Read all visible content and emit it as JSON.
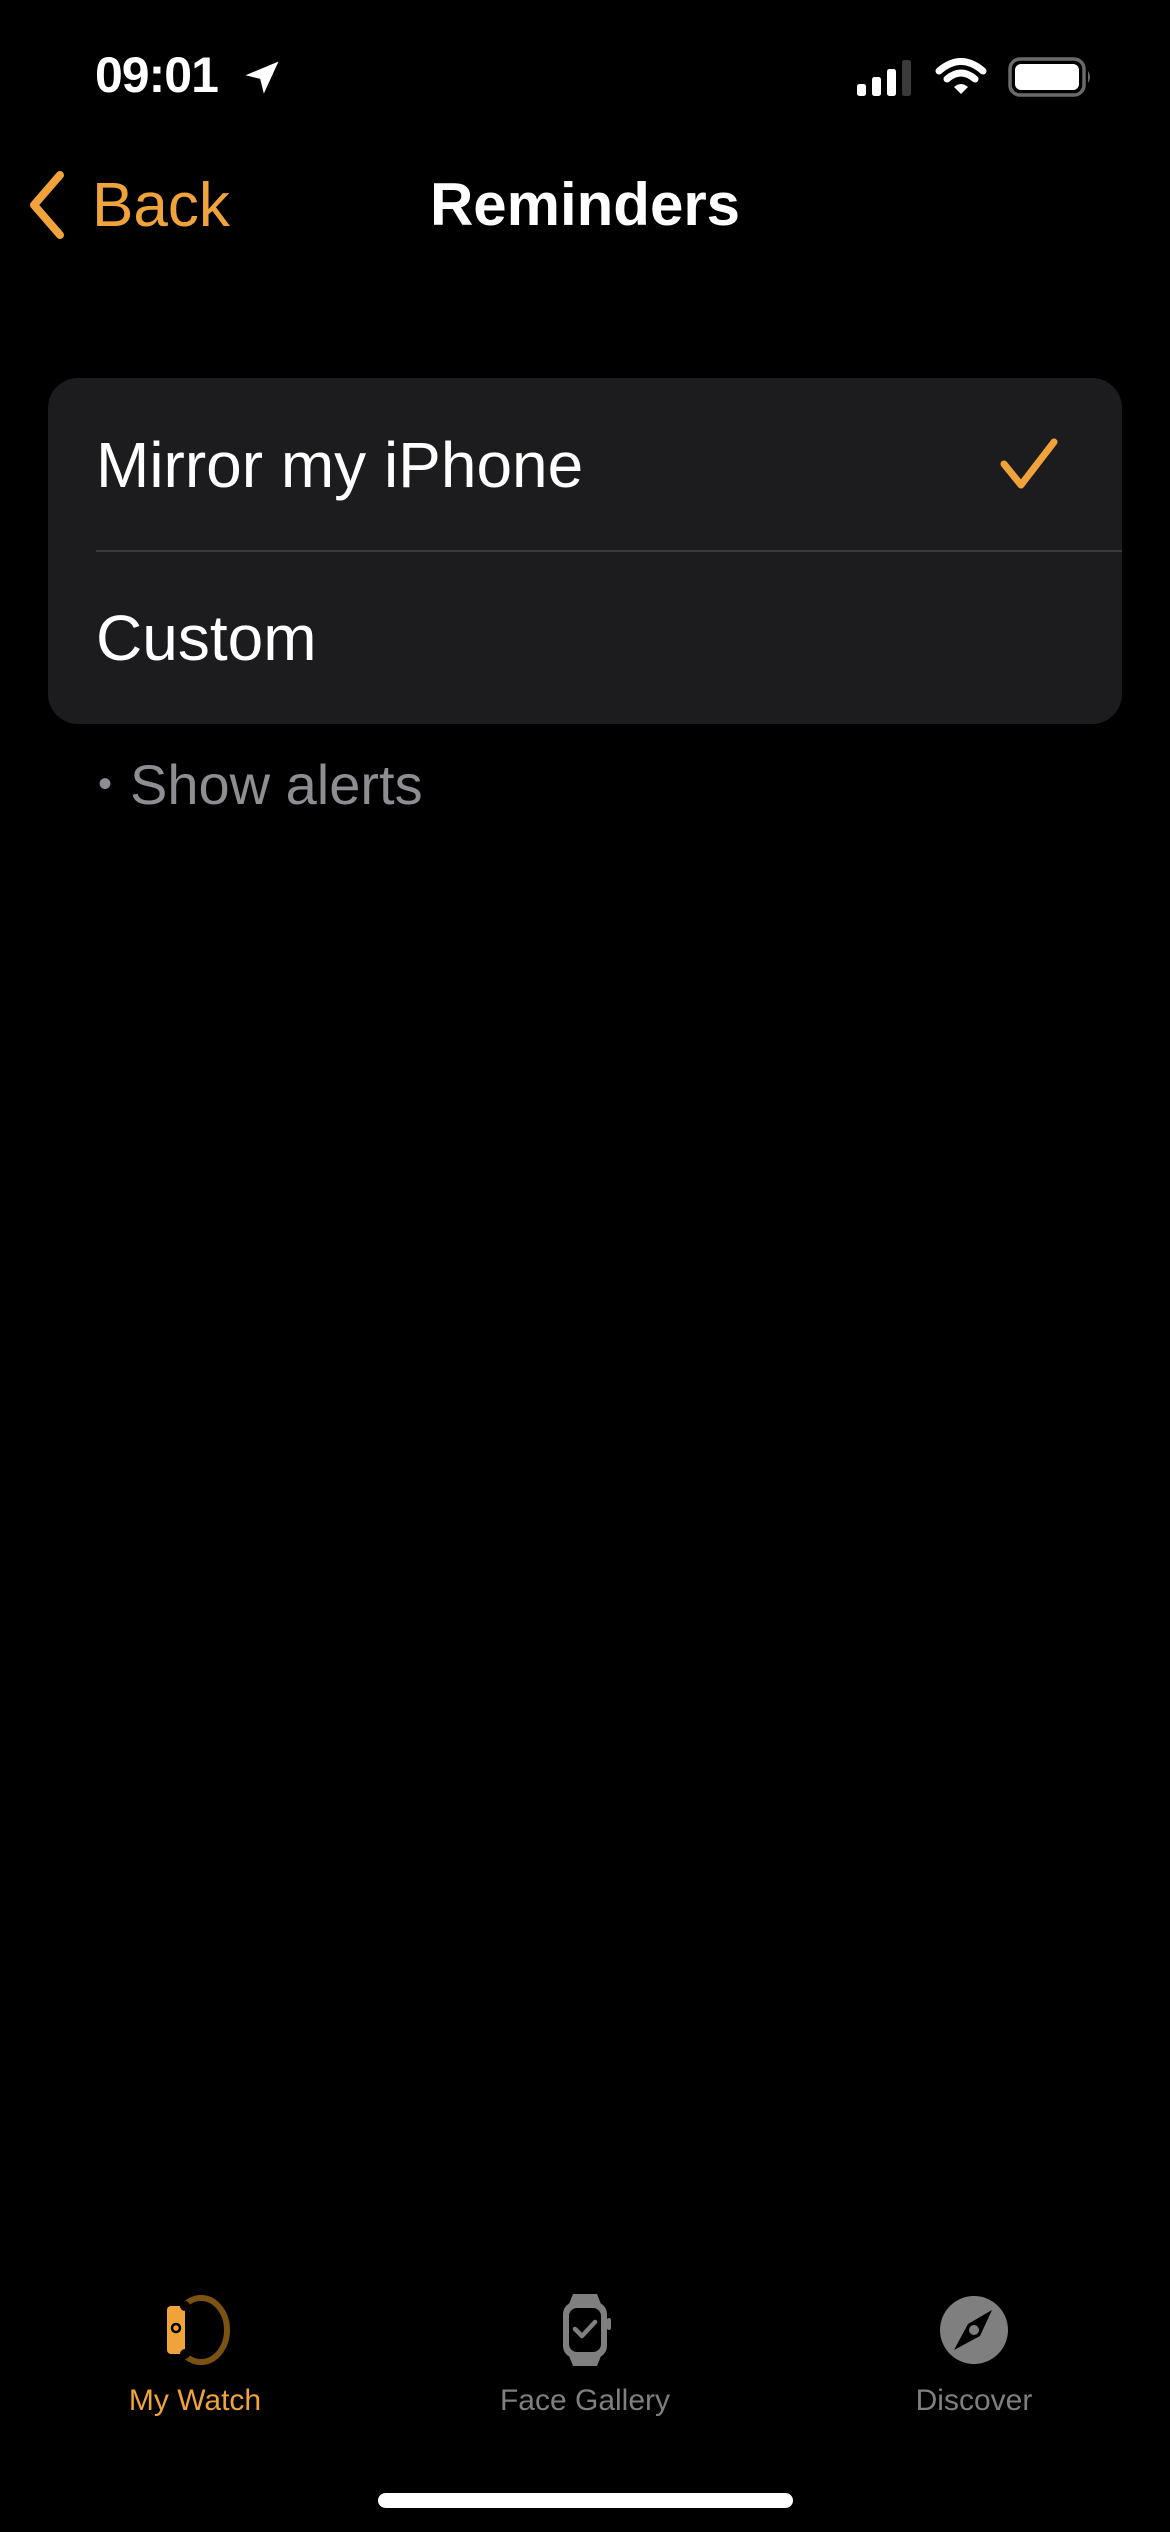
{
  "status_bar": {
    "time": "09:01",
    "icons": [
      "location-arrow-icon",
      "cellular-signal-icon",
      "wifi-icon",
      "battery-icon"
    ]
  },
  "nav": {
    "back_label": "Back",
    "title": "Reminders"
  },
  "options": [
    {
      "label": "Mirror my iPhone",
      "selected": true
    },
    {
      "label": "Custom",
      "selected": false
    }
  ],
  "footer_note": {
    "bullet": "•",
    "text": "Show alerts"
  },
  "tab_bar": {
    "items": [
      {
        "label": "My Watch",
        "icon": "watch-side-icon",
        "active": true
      },
      {
        "label": "Face Gallery",
        "icon": "watch-face-icon",
        "active": false
      },
      {
        "label": "Discover",
        "icon": "compass-icon",
        "active": false
      }
    ]
  },
  "colors": {
    "accent": "#f0a33b",
    "background": "#000000",
    "group_background": "#1c1c1e",
    "secondary_text": "#8d8d92",
    "inactive_tab": "#7f7f7f"
  }
}
